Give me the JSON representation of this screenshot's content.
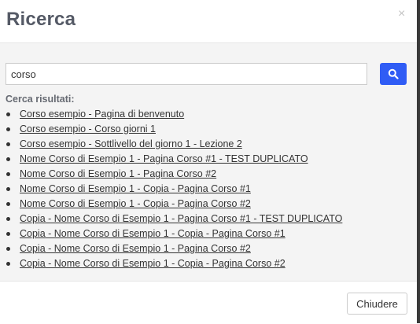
{
  "modal": {
    "title": "Ricerca",
    "close_glyph": "×"
  },
  "search": {
    "value": "corso",
    "button_icon": "search-icon",
    "button_color": "#2f5cf5"
  },
  "results": {
    "label": "Cerca risultati:",
    "items": [
      "Corso esempio - Pagina di benvenuto",
      "Corso esempio - Corso giorni 1",
      "Corso esempio - Sottlivello del giorno 1 - Lezione 2",
      "Nome Corso di Esempio 1 - Pagina Corso #1 - TEST DUPLICATO",
      "Nome Corso di Esempio 1 - Pagina Corso #2",
      "Nome Corso di Esempio 1 - Copia - Pagina Corso #1",
      "Nome Corso di Esempio 1 - Copia - Pagina Corso #2",
      "Copia - Nome Corso di Esempio 1 - Pagina Corso #1 - TEST DUPLICATO",
      "Copia - Nome Corso di Esempio 1 - Copia - Pagina Corso #1",
      "Copia - Nome Corso di Esempio 1 - Pagina Corso #2",
      "Copia - Nome Corso di Esempio 1 - Copia - Pagina Corso #2"
    ]
  },
  "footer": {
    "close_label": "Chiudere"
  }
}
